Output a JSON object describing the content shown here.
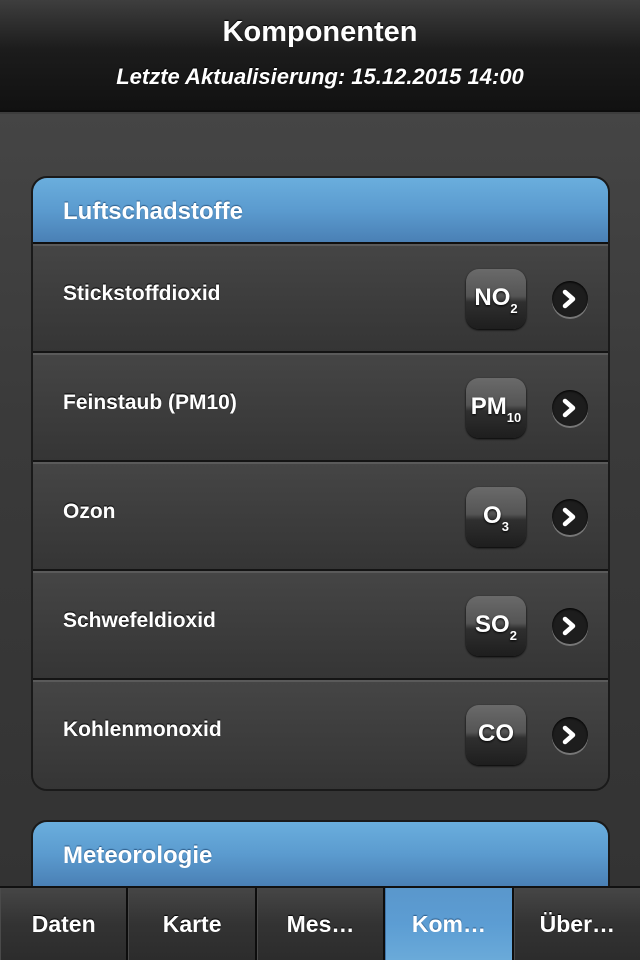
{
  "header": {
    "title": "Komponenten",
    "subtitle": "Letzte Aktualisierung: 15.12.2015 14:00"
  },
  "groups": [
    {
      "title": "Luftschadstoffe",
      "items": [
        {
          "label": "Stickstoffdioxid",
          "icon": {
            "main": "NO",
            "sub": "2",
            "name": "no2-icon"
          }
        },
        {
          "label": "Feinstaub (PM10)",
          "icon": {
            "main": "PM",
            "sub": "10",
            "name": "pm10-icon"
          }
        },
        {
          "label": "Ozon",
          "icon": {
            "main": "O",
            "sub": "3",
            "name": "o3-icon"
          }
        },
        {
          "label": "Schwefeldioxid",
          "icon": {
            "main": "SO",
            "sub": "2",
            "name": "so2-icon"
          }
        },
        {
          "label": "Kohlenmonoxid",
          "icon": {
            "main": "CO",
            "sub": "",
            "name": "co-icon"
          }
        }
      ]
    },
    {
      "title": "Meteorologie",
      "items": []
    }
  ],
  "tabbar": {
    "tabs": [
      {
        "label": "Daten",
        "active": false
      },
      {
        "label": "Karte",
        "active": false
      },
      {
        "label": "Mes…",
        "active": false
      },
      {
        "label": "Kom…",
        "active": true
      },
      {
        "label": "Über…",
        "active": false
      }
    ]
  },
  "colors": {
    "accent": "#5b9bcf",
    "header_bg": "#1c1c1c",
    "background": "#3c3c3c"
  }
}
